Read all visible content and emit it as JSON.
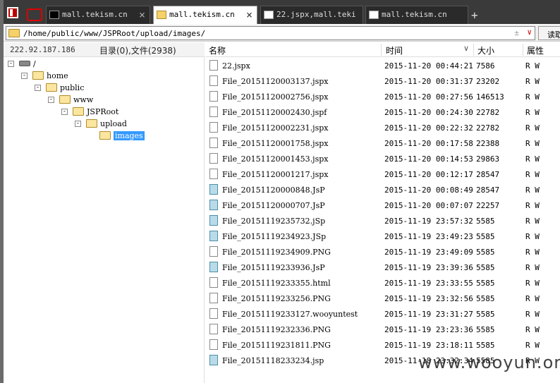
{
  "tabs": [
    {
      "label": "mall.tekism.cn",
      "icon": "terminal-icon",
      "active": false
    },
    {
      "label": "mall.tekism.cn",
      "icon": "folder-icon",
      "active": true
    },
    {
      "label": "22.jspx,mall.teki",
      "icon": "document-icon",
      "active": false
    },
    {
      "label": "mall.tekism.cn",
      "icon": "document-icon",
      "active": false
    }
  ],
  "new_tab": "+",
  "address": {
    "path": "/home/public/www/JSPRoot/upload/images/",
    "read_button": "读取"
  },
  "info": {
    "ip": "222.92.187.186",
    "counts": "目录(0),文件(2938)"
  },
  "tree": [
    {
      "label": "/",
      "type": "drive"
    },
    {
      "label": "home"
    },
    {
      "label": "public"
    },
    {
      "label": "www"
    },
    {
      "label": "JSPRoot"
    },
    {
      "label": "upload"
    },
    {
      "label": "images",
      "selected": true
    }
  ],
  "columns": {
    "name": "名称",
    "time": "时间",
    "size": "大小",
    "attr": "属性"
  },
  "files": [
    {
      "name": "22.jspx",
      "time": "2015-11-20 00:44:21",
      "size": "7586",
      "attr": "R W",
      "icon": "plain"
    },
    {
      "name": "File_20151120003137.jspx",
      "time": "2015-11-20 00:31:37",
      "size": "23202",
      "attr": "R W",
      "icon": "plain"
    },
    {
      "name": "File_20151120002756.jspx",
      "time": "2015-11-20 00:27:56",
      "size": "146513",
      "attr": "R W",
      "icon": "plain"
    },
    {
      "name": "File_20151120002430.jspf",
      "time": "2015-11-20 00:24:30",
      "size": "22782",
      "attr": "R W",
      "icon": "plain"
    },
    {
      "name": "File_20151120002231.jspx",
      "time": "2015-11-20 00:22:32",
      "size": "22782",
      "attr": "R W",
      "icon": "plain"
    },
    {
      "name": "File_20151120001758.jspx",
      "time": "2015-11-20 00:17:58",
      "size": "22388",
      "attr": "R W",
      "icon": "plain"
    },
    {
      "name": "File_20151120001453.jspx",
      "time": "2015-11-20 00:14:53",
      "size": "29863",
      "attr": "R W",
      "icon": "plain"
    },
    {
      "name": "File_20151120001217.jspx",
      "time": "2015-11-20 00:12:17",
      "size": "28547",
      "attr": "R W",
      "icon": "plain"
    },
    {
      "name": "File_20151120000848.JsP",
      "time": "2015-11-20 00:08:49",
      "size": "28547",
      "attr": "R W",
      "icon": "jsp"
    },
    {
      "name": "File_20151120000707.JsP",
      "time": "2015-11-20 00:07:07",
      "size": "22257",
      "attr": "R W",
      "icon": "jsp"
    },
    {
      "name": "File_20151119235732.jSp",
      "time": "2015-11-19 23:57:32",
      "size": "5585",
      "attr": "R W",
      "icon": "jsp"
    },
    {
      "name": "File_20151119234923.JSp",
      "time": "2015-11-19 23:49:23",
      "size": "5585",
      "attr": "R W",
      "icon": "jsp"
    },
    {
      "name": "File_20151119234909.PNG",
      "time": "2015-11-19 23:49:09",
      "size": "5585",
      "attr": "R W",
      "icon": "plain"
    },
    {
      "name": "File_20151119233936.JsP",
      "time": "2015-11-19 23:39:36",
      "size": "5585",
      "attr": "R W",
      "icon": "jsp"
    },
    {
      "name": "File_20151119233355.html",
      "time": "2015-11-19 23:33:55",
      "size": "5585",
      "attr": "R W",
      "icon": "plain"
    },
    {
      "name": "File_20151119233256.PNG",
      "time": "2015-11-19 23:32:56",
      "size": "5585",
      "attr": "R W",
      "icon": "plain"
    },
    {
      "name": "File_20151119233127.wooyuntest",
      "time": "2015-11-19 23:31:27",
      "size": "5585",
      "attr": "R W",
      "icon": "plain"
    },
    {
      "name": "File_20151119232336.PNG",
      "time": "2015-11-19 23:23:36",
      "size": "5585",
      "attr": "R W",
      "icon": "plain"
    },
    {
      "name": "File_20151119231811.PNG",
      "time": "2015-11-19 23:18:11",
      "size": "5585",
      "attr": "R W",
      "icon": "plain"
    },
    {
      "name": "File_20151118233234.jsp",
      "time": "2015-11-18 23:32:34",
      "size": "5585",
      "attr": "R W",
      "icon": "jsp"
    }
  ],
  "watermark": "www.wooyun.org"
}
